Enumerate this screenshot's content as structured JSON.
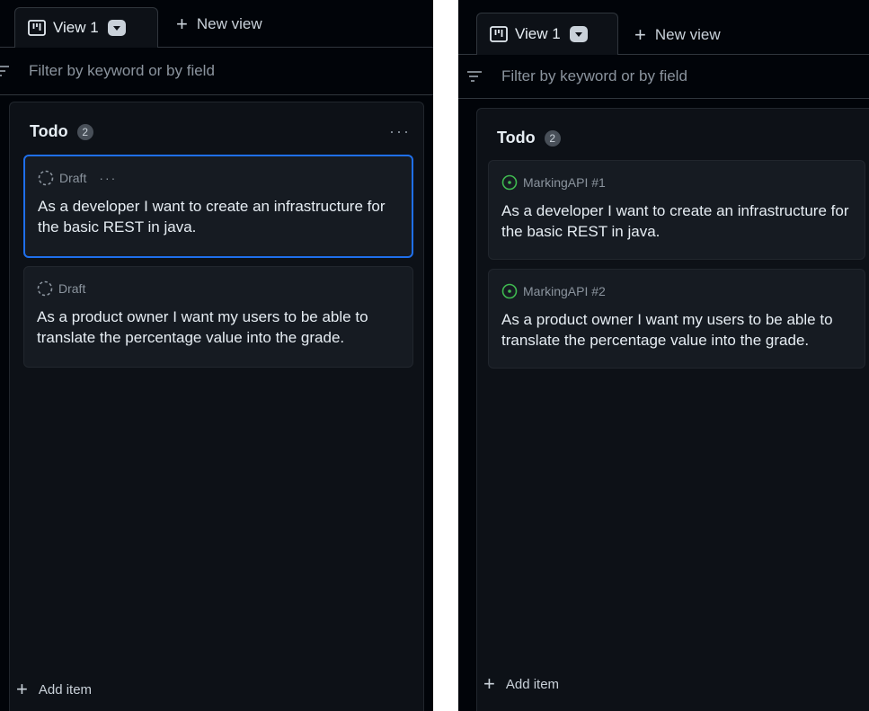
{
  "tabs": {
    "view_label": "View 1",
    "new_view_label": "New view"
  },
  "filter": {
    "placeholder": "Filter by keyword or by field"
  },
  "column": {
    "title": "Todo",
    "count": "2",
    "more": "···",
    "add_item": "Add item"
  },
  "left": {
    "cards": [
      {
        "tag": "Draft",
        "title": "As a developer I want to create an infrastructure for the basic REST in java."
      },
      {
        "tag": "Draft",
        "title": "As a product owner I want my users to be able to translate the percentage value into the grade."
      }
    ]
  },
  "right": {
    "cards": [
      {
        "tag": "MarkingAPI #1",
        "title": "As a developer I want to create an infrastructure for the basic REST in java."
      },
      {
        "tag": "MarkingAPI #2",
        "title": "As a product owner I want my users to be able to translate the percentage value into the grade."
      }
    ]
  },
  "colors": {
    "background": "#010409",
    "column": "#0d1117",
    "card": "#161b22",
    "border": "#30363d",
    "selection": "#1f6feb",
    "open_issue": "#3fb950"
  }
}
